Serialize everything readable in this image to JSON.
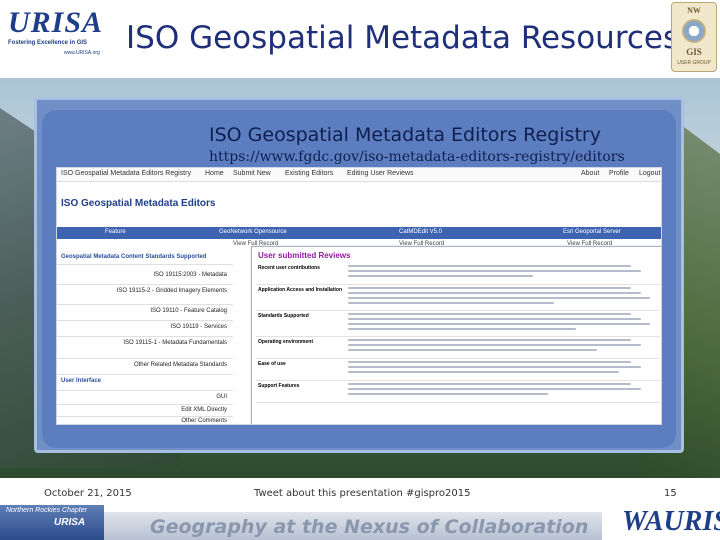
{
  "slide": {
    "title": "ISO Geospatial Metadata Resources",
    "registry_title": "ISO Geospatial Metadata Editors Registry",
    "registry_url": "https://www.fgdc.gov/iso-metadata-editors-registry/editors"
  },
  "logos": {
    "urisa_word": "URISA",
    "urisa_tagline": "Fostering Excellence in GIS",
    "urisa_url": "www.URISA.org",
    "nwgis_top": "NW",
    "nwgis_bottom": "GIS",
    "nwgis_group": "USER GROUP",
    "chapter_name": "Northern Rockies Chapter",
    "chapter_urisa": "URISA",
    "wa_urisa": "WAURISA"
  },
  "webpage": {
    "nav": [
      "ISO Geospatial Metadata Editors Registry",
      "Home",
      "Submit New",
      "Existing Editors",
      "Editing User Reviews",
      "About",
      "Profile",
      "Logout"
    ],
    "heading": "ISO Geospatial Metadata Editors",
    "columns": [
      "Feature",
      "GeoNetwork Opensource",
      "CatMDEdit V5.0",
      "Esri Geoportal Server"
    ],
    "view_full_record": "View Full Record",
    "left_rows": [
      {
        "text": "Geospatial Metadata Content Standards Supported",
        "type": "section"
      },
      {
        "text": "ISO 19115:2003 - Metadata",
        "type": "right"
      },
      {
        "text": "ISO 19115-2 - Gridded Imagery Elements",
        "type": "right"
      },
      {
        "text": "ISO 19110 - Feature Catalog",
        "type": "right"
      },
      {
        "text": "ISO 19119 - Services",
        "type": "right"
      },
      {
        "text": "ISO 19115-1 - Metadata Fundamentals",
        "type": "right"
      },
      {
        "text": "Other Related Metadata Standards",
        "type": "right"
      },
      {
        "text": "User Interface",
        "type": "section"
      },
      {
        "text": "GUI",
        "type": "right"
      },
      {
        "text": "Edit XML Directly",
        "type": "right"
      },
      {
        "text": "Other Comments",
        "type": "right"
      }
    ]
  },
  "reviews": {
    "title": "User submitted Reviews",
    "items": [
      {
        "label": "Recent user contributions",
        "lines": 3
      },
      {
        "label": "Application Access and Installation",
        "lines": 4
      },
      {
        "label": "Standards Supported",
        "lines": 4
      },
      {
        "label": "Operating environment",
        "lines": 3
      },
      {
        "label": "Ease of use",
        "lines": 3
      },
      {
        "label": "Support Features",
        "lines": 3
      }
    ]
  },
  "footer": {
    "date": "October 21, 2015",
    "tweet": "Tweet about this presentation #gispro2015",
    "page": "15",
    "banner": "Geography at the Nexus of Collaboration"
  }
}
